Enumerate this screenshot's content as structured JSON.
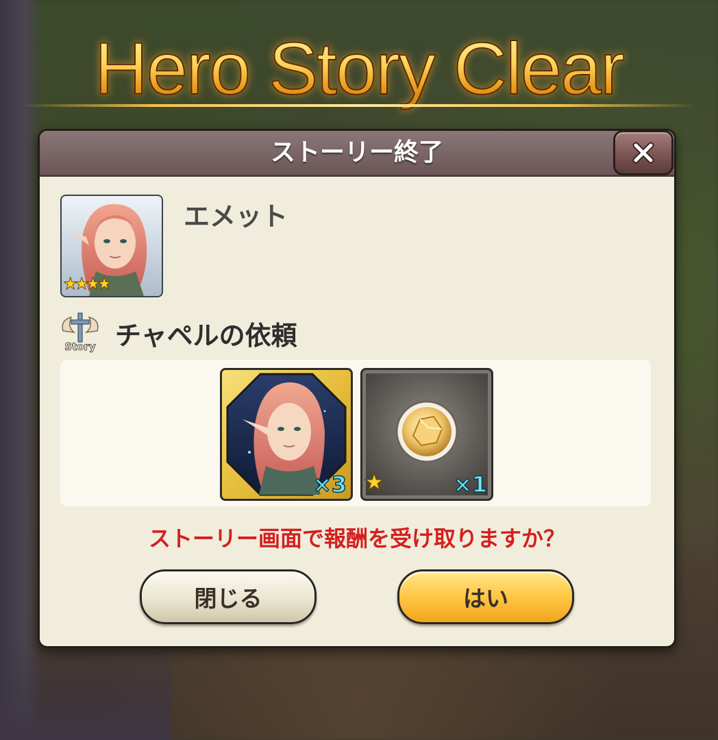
{
  "banner": {
    "title": "Hero Story Clear"
  },
  "dialog": {
    "title": "ストーリー終了",
    "close_icon": "close-x-icon",
    "hero": {
      "name": "エメット",
      "rarity_stars": "★★★★"
    },
    "story": {
      "icon_label": "Story",
      "title": "チャペルの依頼"
    },
    "rewards": [
      {
        "name": "hero-shard",
        "quantity": "×3"
      },
      {
        "name": "gold-ore",
        "rarity_star": "★",
        "quantity": "×1"
      }
    ],
    "prompt": "ストーリー画面で報酬を受け取りますか？",
    "buttons": {
      "close": "閉じる",
      "yes": "はい"
    }
  },
  "colors": {
    "prompt": "#d51f1f",
    "yes_button": "#ffc644",
    "header": "#7a6567"
  }
}
